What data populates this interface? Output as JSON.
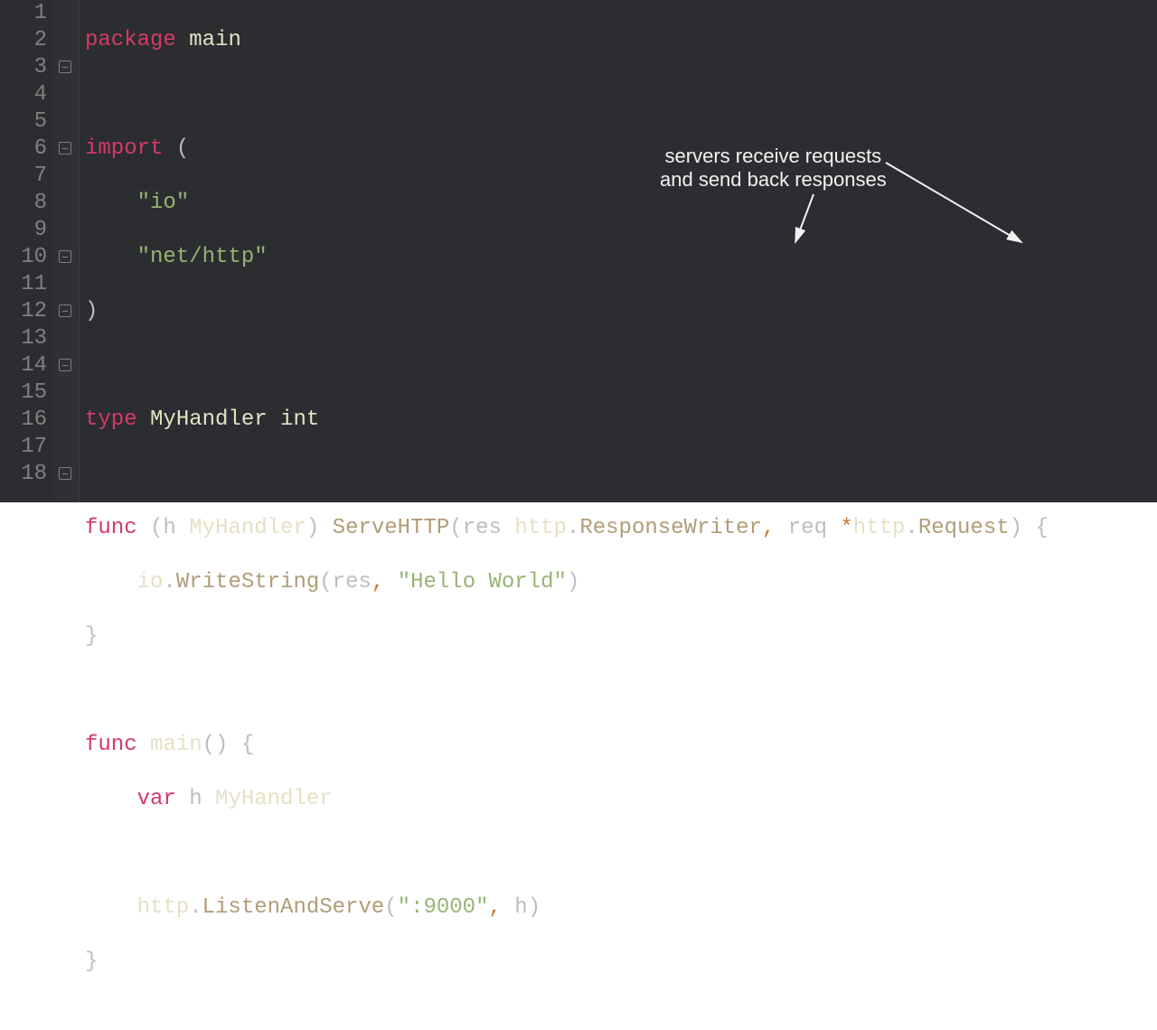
{
  "lines": {
    "count": 18,
    "numbers": [
      "1",
      "2",
      "3",
      "4",
      "5",
      "6",
      "7",
      "8",
      "9",
      "10",
      "11",
      "12",
      "13",
      "14",
      "15",
      "16",
      "17",
      "18"
    ]
  },
  "code": {
    "l1_kw": "package",
    "l1_id": "main",
    "l3_kw": "import",
    "l3_open": "(",
    "l4_str": "\"io\"",
    "l5_str": "\"net/http\"",
    "l6_close": ")",
    "l8_kw": "type",
    "l8_id": "MyHandler",
    "l8_ty": "int",
    "l10_kw": "func",
    "l10_recv_open": "(h ",
    "l10_recv_ty": "MyHandler",
    "l10_recv_close": ")",
    "l10_name": "ServeHTTP",
    "l10_p_open": "(res ",
    "l10_p_pkg1": "http",
    "l10_dot1": ".",
    "l10_p_ty1": "ResponseWriter",
    "l10_comma": ",",
    "l10_p_req": " req ",
    "l10_star": "*",
    "l10_p_pkg2": "http",
    "l10_dot2": ".",
    "l10_p_ty2": "Request",
    "l10_p_close": ")",
    "l10_brace": " {",
    "l11_pkg": "io",
    "l11_dot": ".",
    "l11_fn": "WriteString",
    "l11_open": "(res",
    "l11_comma": ",",
    "l11_sp": " ",
    "l11_str": "\"Hello World\"",
    "l11_close": ")",
    "l12_brace": "}",
    "l14_kw": "func",
    "l14_name": "main",
    "l14_parens": "()",
    "l14_brace": " {",
    "l15_kw": "var",
    "l15_id": " h ",
    "l15_ty": "MyHandler",
    "l17_pkg": "http",
    "l17_dot": ".",
    "l17_fn": "ListenAndServe",
    "l17_open": "(",
    "l17_str": "\":9000\"",
    "l17_comma": ",",
    "l17_arg": " h",
    "l17_close": ")",
    "l18_brace": "}"
  },
  "annotation": {
    "line1": "servers receive requests",
    "line2": "and send back responses"
  },
  "fold_markers": [
    {
      "line": 3,
      "kind": "open"
    },
    {
      "line": 6,
      "kind": "close"
    },
    {
      "line": 10,
      "kind": "open"
    },
    {
      "line": 12,
      "kind": "close"
    },
    {
      "line": 14,
      "kind": "open"
    },
    {
      "line": 18,
      "kind": "close"
    }
  ],
  "colors": {
    "bg": "#2b2d30",
    "keyword_pink": "#d6396a",
    "keyword_orange": "#cc7832",
    "string_green": "#98b474",
    "ident_cream": "#e6e1c4",
    "member_tan": "#b09d79"
  }
}
